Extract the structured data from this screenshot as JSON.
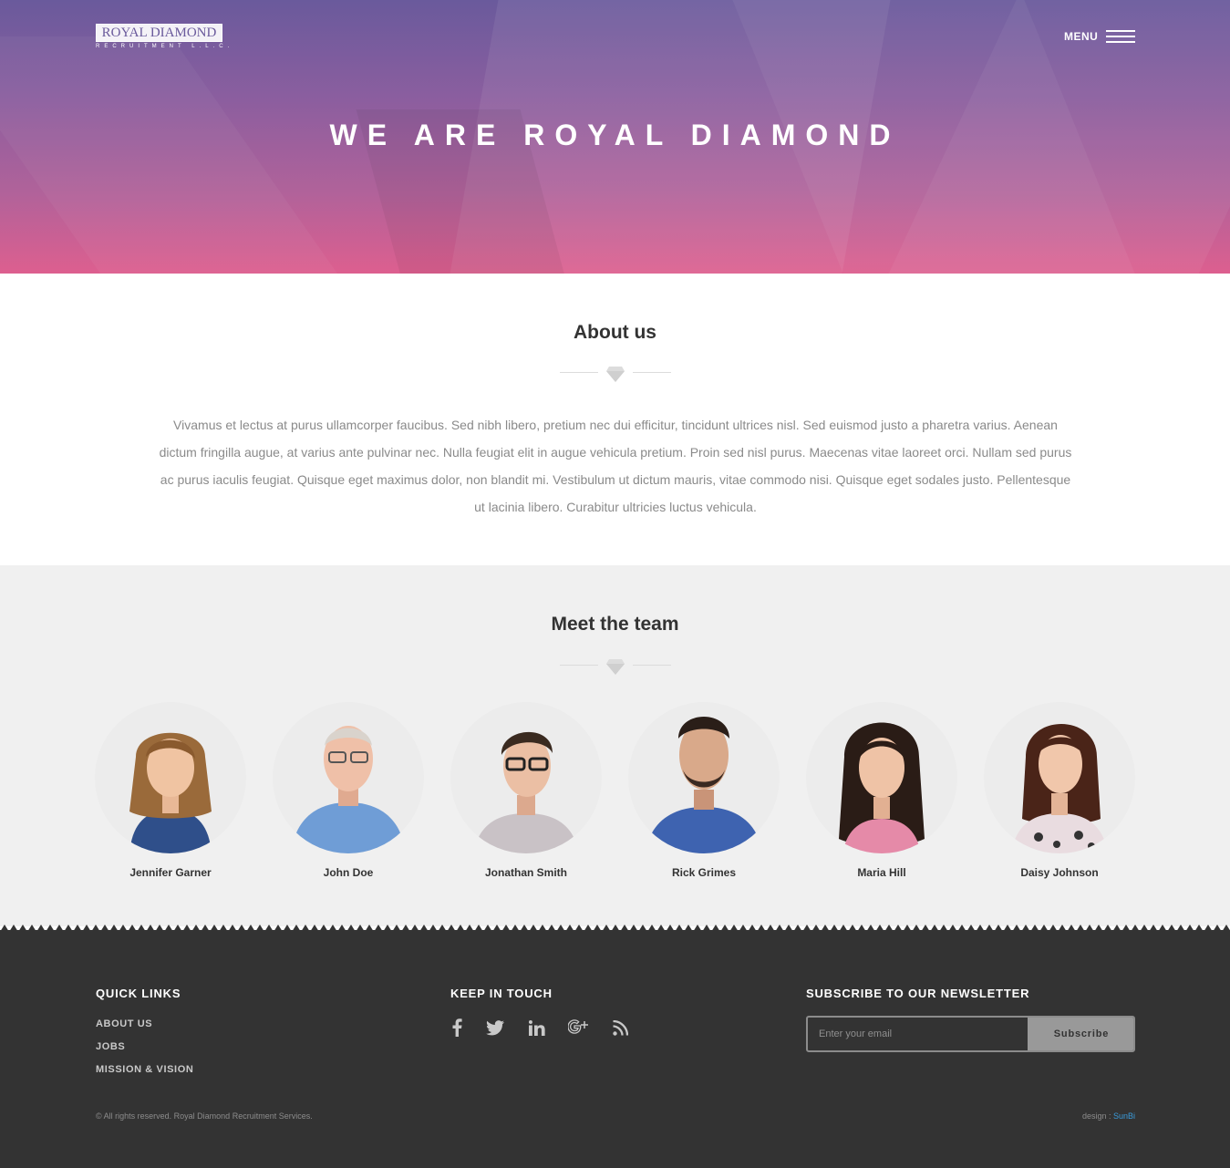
{
  "header": {
    "logo_text": "ROYAL DIAMOND",
    "logo_subtext": "RECRUITMENT L.L.C.",
    "menu_label": "MENU",
    "hero_title": "WE ARE ROYAL DIAMOND"
  },
  "about": {
    "title": "About us",
    "body": "Vivamus et lectus at purus ullamcorper faucibus. Sed nibh libero, pretium nec dui efficitur, tincidunt ultrices nisl. Sed euismod justo a pharetra varius. Aenean dictum fringilla augue, at varius ante pulvinar nec. Nulla feugiat elit in augue vehicula pretium. Proin sed nisl purus. Maecenas vitae laoreet orci. Nullam sed purus ac purus iaculis feugiat. Quisque eget maximus dolor, non blandit mi. Vestibulum ut dictum mauris, vitae commodo nisi. Quisque eget sodales justo. Pellentesque ut lacinia libero. Curabitur ultricies luctus vehicula."
  },
  "team": {
    "title": "Meet the team",
    "members": [
      {
        "name": "Jennifer Garner"
      },
      {
        "name": "John Doe"
      },
      {
        "name": "Jonathan Smith"
      },
      {
        "name": "Rick Grimes"
      },
      {
        "name": "Maria Hill"
      },
      {
        "name": "Daisy Johnson"
      }
    ]
  },
  "footer": {
    "quick_links_title": "QUICK LINKS",
    "quick_links": [
      "ABOUT US",
      "JOBS",
      "MISSION & VISION"
    ],
    "keep_in_touch_title": "KEEP IN TOUCH",
    "social_icons": [
      "facebook-icon",
      "twitter-icon",
      "linkedin-icon",
      "google-plus-icon",
      "rss-icon"
    ],
    "newsletter_title": "SUBSCRIBE TO OUR NEWSLETTER",
    "newsletter_placeholder": "Enter your email",
    "subscribe_label": "Subscribe",
    "copyright": "© All rights reserved. Royal Diamond Recruitment Services.",
    "design_label": "design : ",
    "design_credit": "SunBi"
  },
  "colors": {
    "hero_top": "#6a5a9c",
    "hero_bottom": "#dd5f8f",
    "team_background": "#f0f0f0",
    "footer_background": "#333333",
    "credit_link": "#3a9ad9"
  }
}
